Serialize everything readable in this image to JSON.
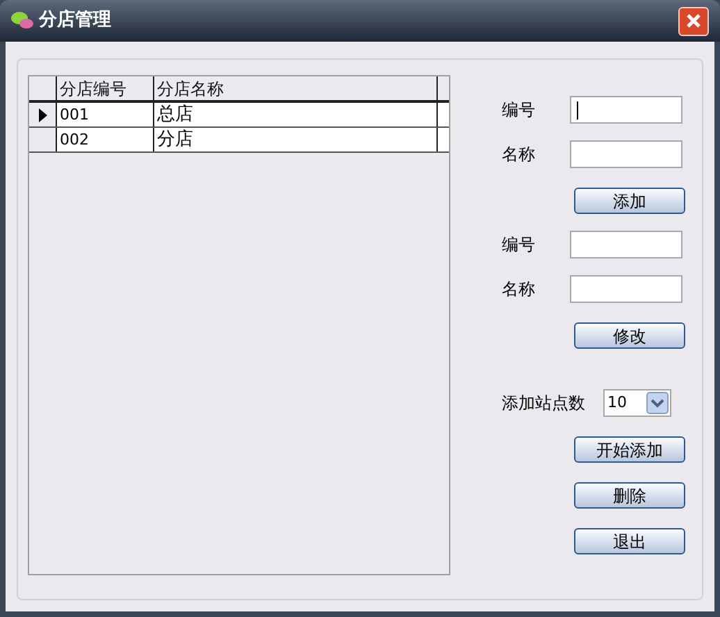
{
  "window": {
    "title": "分店管理"
  },
  "grid": {
    "columns": [
      "分店编号",
      "分店名称"
    ],
    "rows": [
      {
        "cells": [
          "001",
          "总店"
        ],
        "selected": true
      },
      {
        "cells": [
          "002",
          "分店"
        ],
        "selected": false
      }
    ]
  },
  "form": [
    {
      "kind": "field",
      "label": "编号",
      "focused": true
    },
    {
      "kind": "field",
      "label": "名称",
      "focused": false
    },
    {
      "kind": "button",
      "label": "添加"
    },
    {
      "kind": "field",
      "label": "编号",
      "focused": false
    },
    {
      "kind": "field",
      "label": "名称",
      "focused": false
    },
    {
      "kind": "button",
      "label": "修改"
    },
    {
      "kind": "select",
      "label": "添加站点数",
      "value": "10"
    },
    {
      "kind": "button",
      "label": "开始添加"
    },
    {
      "kind": "button",
      "label": "删除"
    },
    {
      "kind": "button",
      "label": "退出"
    }
  ]
}
